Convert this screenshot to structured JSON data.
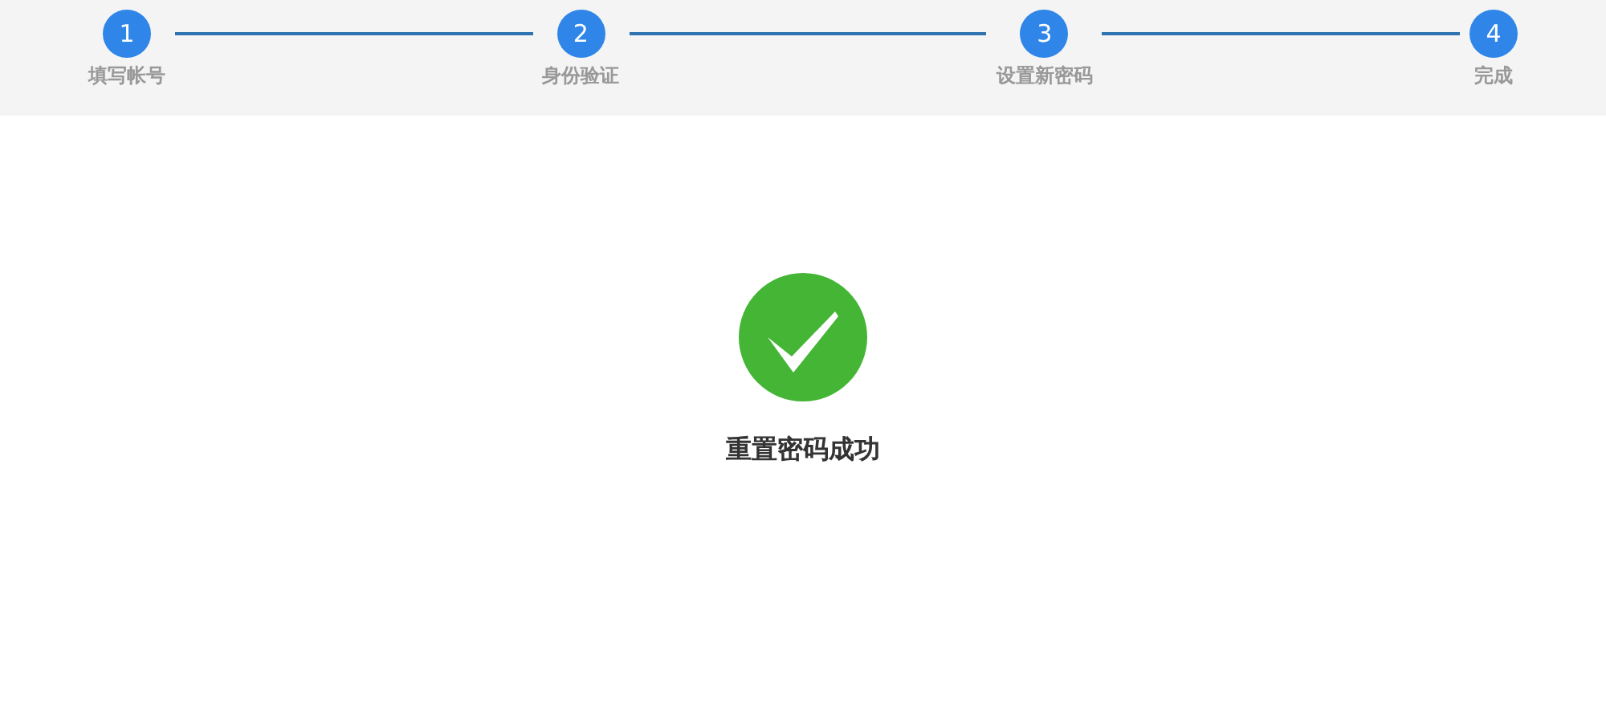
{
  "steps": [
    {
      "number": "1",
      "label": "填写帐号",
      "done": true
    },
    {
      "number": "2",
      "label": "身份验证",
      "done": true
    },
    {
      "number": "3",
      "label": "设置新密码",
      "done": true
    },
    {
      "number": "4",
      "label": "完成",
      "done": true
    }
  ],
  "result": {
    "message": "重置密码成功"
  }
}
